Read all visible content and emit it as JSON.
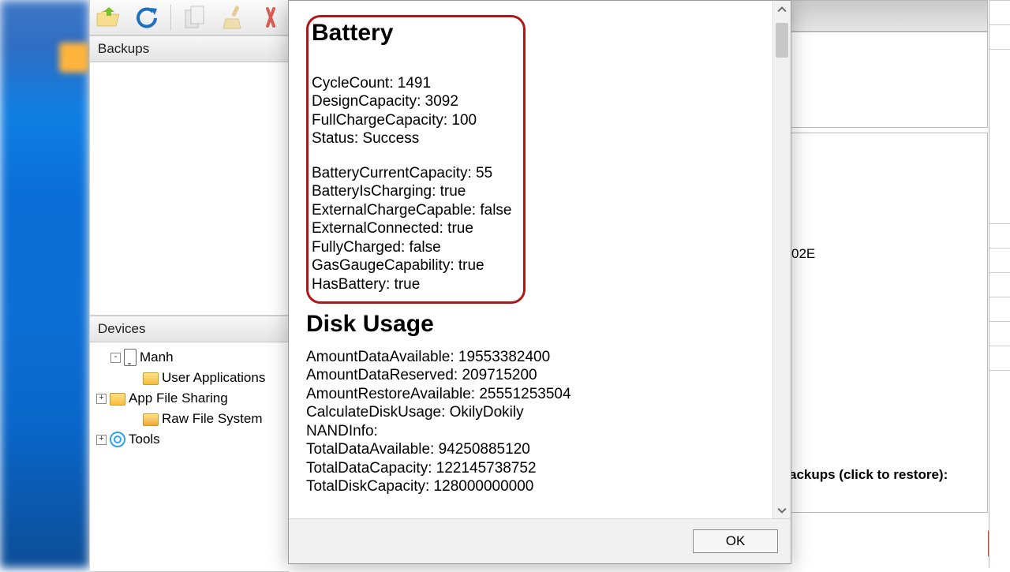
{
  "sidebar": {
    "backups_header": "Backups",
    "devices_header": "Devices",
    "device_name": "Manh",
    "tree": {
      "user_apps": "User Applications",
      "app_file_sharing": "App File Sharing",
      "raw_fs": "Raw File System",
      "tools": "Tools"
    }
  },
  "toolbar_icons": {
    "open": "open-folder-icon",
    "refresh": "refresh-icon",
    "copy": "copy-icon",
    "brush": "brush-icon",
    "delete": "delete-icon"
  },
  "modal": {
    "close": "×",
    "ok": "OK",
    "battery": {
      "heading": "Battery",
      "rows1": [
        {
          "k": "CycleCount",
          "v": "1491"
        },
        {
          "k": "DesignCapacity",
          "v": "3092"
        },
        {
          "k": "FullChargeCapacity",
          "v": "100"
        },
        {
          "k": "Status",
          "v": "Success"
        }
      ],
      "rows2": [
        {
          "k": "BatteryCurrentCapacity",
          "v": "55"
        },
        {
          "k": "BatteryIsCharging",
          "v": "true"
        },
        {
          "k": "ExternalChargeCapable",
          "v": "false"
        },
        {
          "k": "ExternalConnected",
          "v": "true"
        },
        {
          "k": "FullyCharged",
          "v": "false"
        },
        {
          "k": "GasGaugeCapability",
          "v": "true"
        },
        {
          "k": "HasBattery",
          "v": "true"
        }
      ]
    },
    "disk": {
      "heading": "Disk Usage",
      "rows": [
        {
          "k": "AmountDataAvailable",
          "v": "19553382400"
        },
        {
          "k": "AmountDataReserved",
          "v": "209715200"
        },
        {
          "k": "AmountRestoreAvailable",
          "v": "25551253504"
        },
        {
          "k": "CalculateDiskUsage",
          "v": "OkilyDokily"
        },
        {
          "k": "NANDInfo",
          "v": ""
        },
        {
          "k": "TotalDataAvailable",
          "v": "94250885120"
        },
        {
          "k": "TotalDataCapacity",
          "v": "122145738752"
        },
        {
          "k": "TotalDiskCapacity",
          "v": "128000000000"
        }
      ]
    }
  },
  "background": {
    "serial_tail": "02E",
    "backups_hint": "ackups (click to restore):"
  }
}
